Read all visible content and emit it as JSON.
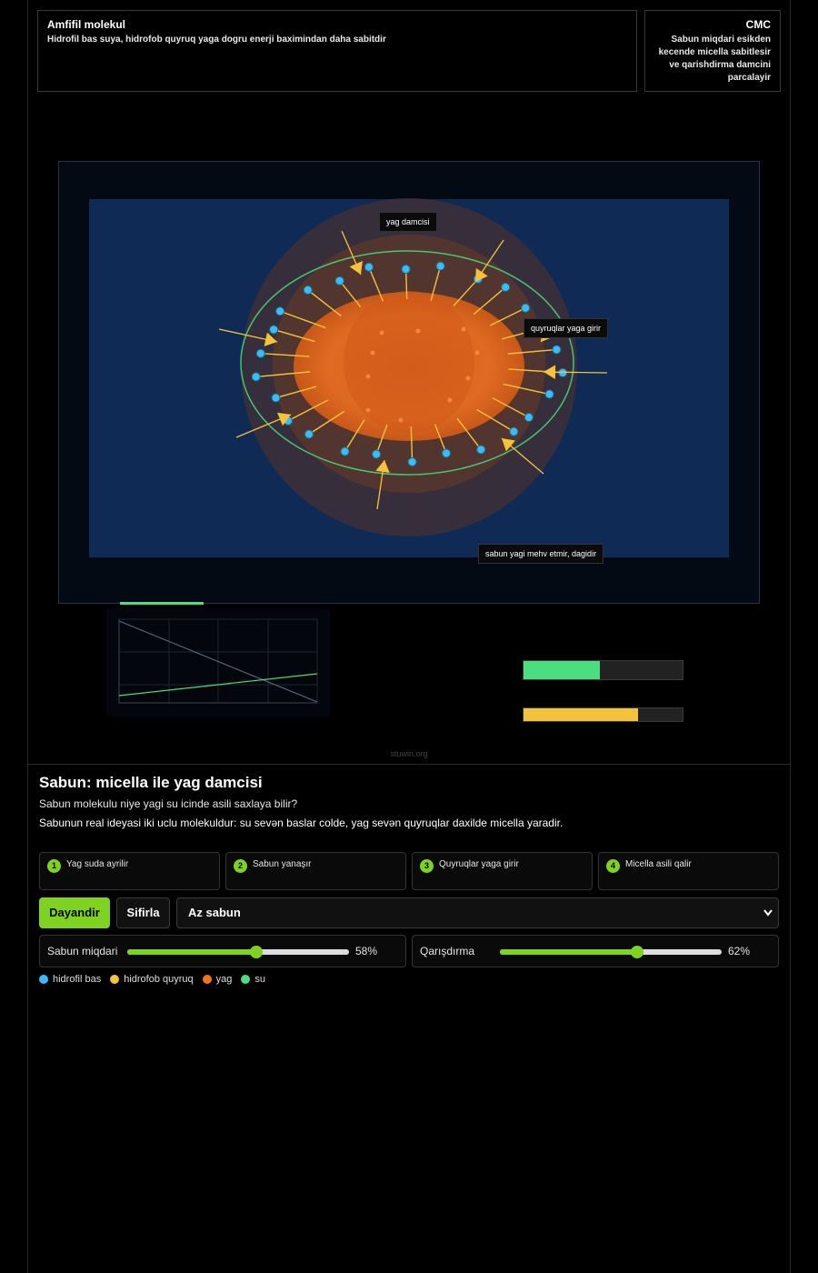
{
  "info_left": {
    "title": "Amfifil molekul",
    "text": "Hidrofil bas suya, hidrofob quyruq yaga dogru enerji baximindan daha sabitdir"
  },
  "info_right": {
    "title": "CMC",
    "text": "Sabun miqdari esikden kecende micella sabitlesir ve qarishdirma damcini parcalayir"
  },
  "simulation": {
    "labels": {
      "droplet": "yag damcisi",
      "tails": "quyruqlar yaga girir",
      "dissolve": "sabun yagi mehv etmir, dagidir"
    }
  },
  "meters": {
    "green_fraction": 0.48,
    "yellow_fraction": 0.72
  },
  "watermark": "stuwin.org",
  "page": {
    "title": "Sabun: micella ile yag damcisi",
    "question": "Sabun molekulu niye yagi su icinde asili saxlaya bilir?",
    "description": "Sabunun real ideyasi iki uclu molekuldur: su sevən baslar colde, yag sevən quyruqlar daxilde micella yaradir."
  },
  "steps": [
    {
      "num": "1",
      "label": "Yag suda ayrilir"
    },
    {
      "num": "2",
      "label": "Sabun yanaşır"
    },
    {
      "num": "3",
      "label": "Quyruqlar yaga girir"
    },
    {
      "num": "4",
      "label": "Micella asili qalir"
    }
  ],
  "controls": {
    "pause_label": "Dayandir",
    "reset_label": "Sifirla",
    "mode_selected": "Az sabun"
  },
  "sliders": [
    {
      "label": "Sabun miqdari",
      "value": 58,
      "display": "58%"
    },
    {
      "label": "Qarışdırma",
      "value": 62,
      "display": "62%"
    }
  ],
  "legend": [
    {
      "label": "hidrofil bas",
      "color": "#38bdf8"
    },
    {
      "label": "hidrofob quyruq",
      "color": "#f5c33b"
    },
    {
      "label": "yag",
      "color": "#f97316"
    },
    {
      "label": "su",
      "color": "#4ade80"
    }
  ],
  "colors": {
    "accent": "#7ed321",
    "water_bg": "#0f2a55",
    "oil": "#e06020",
    "head": "#38bdf8",
    "tail": "#f5c33b",
    "ring": "#4ade80"
  }
}
